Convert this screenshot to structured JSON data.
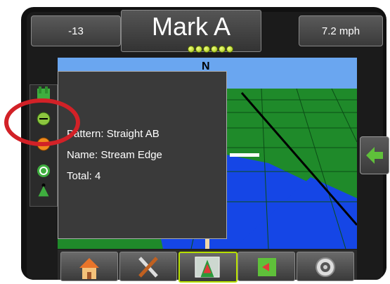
{
  "header": {
    "left_value": "-13",
    "title": "Mark A",
    "right_value": "7.2 mph"
  },
  "map": {
    "compass": "N"
  },
  "info_panel": {
    "pattern": "Pattern: Straight AB",
    "name": "Name: Stream Edge",
    "total": "Total: 4"
  },
  "left_toolbar": {
    "icons": [
      "field-icon",
      "guideline-icon",
      "marker-icon",
      "steering-icon",
      "vehicle-icon"
    ]
  },
  "right_panel": {
    "icon": "arrow-left-icon"
  },
  "bottom_nav": {
    "tabs": [
      "home-icon",
      "tools-icon",
      "guidance-icon",
      "map-icon",
      "settings-icon"
    ]
  },
  "colors": {
    "accent": "#b8e000",
    "highlight": "#d22127",
    "ground": "#1f8a2a",
    "sky": "#6aa6f0",
    "water": "#1546e6"
  }
}
